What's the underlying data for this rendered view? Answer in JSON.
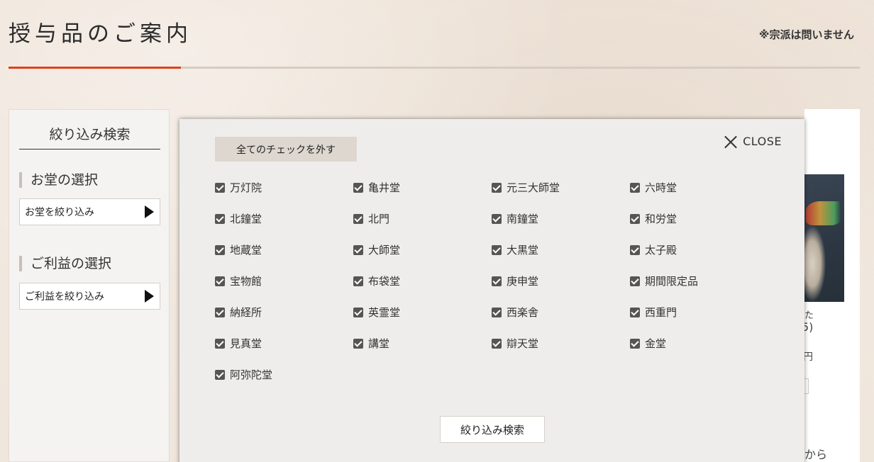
{
  "header": {
    "title": "授与品のご案内",
    "note": "※宗派は問いません"
  },
  "sidebar": {
    "heading": "絞り込み検索",
    "hall_section": {
      "title": "お堂の選択",
      "select_label": "お堂を絞り込み"
    },
    "benefit_section": {
      "title": "ご利益の選択",
      "select_label": "ご利益を絞り込み"
    }
  },
  "background": {
    "partial_texts": [
      "た",
      "5)",
      "円",
      "から"
    ]
  },
  "modal": {
    "uncheck_all_label": "全てのチェックを外す",
    "close_label": "CLOSE",
    "search_button_label": "絞り込み検索",
    "options": [
      {
        "label": "万灯院",
        "checked": true
      },
      {
        "label": "亀井堂",
        "checked": true
      },
      {
        "label": "元三大師堂",
        "checked": true
      },
      {
        "label": "六時堂",
        "checked": true
      },
      {
        "label": "北鐘堂",
        "checked": true
      },
      {
        "label": "北門",
        "checked": true
      },
      {
        "label": "南鐘堂",
        "checked": true
      },
      {
        "label": "和労堂",
        "checked": true
      },
      {
        "label": "地蔵堂",
        "checked": true
      },
      {
        "label": "大師堂",
        "checked": true
      },
      {
        "label": "大黒堂",
        "checked": true
      },
      {
        "label": "太子殿",
        "checked": true
      },
      {
        "label": "宝物館",
        "checked": true
      },
      {
        "label": "布袋堂",
        "checked": true
      },
      {
        "label": "庚申堂",
        "checked": true
      },
      {
        "label": "期間限定品",
        "checked": true
      },
      {
        "label": "納経所",
        "checked": true
      },
      {
        "label": "英霊堂",
        "checked": true
      },
      {
        "label": "西楽舎",
        "checked": true
      },
      {
        "label": "西重門",
        "checked": true
      },
      {
        "label": "見真堂",
        "checked": true
      },
      {
        "label": "講堂",
        "checked": true
      },
      {
        "label": "辯天堂",
        "checked": true
      },
      {
        "label": "金堂",
        "checked": true
      },
      {
        "label": "阿弥陀堂",
        "checked": true
      }
    ]
  },
  "colors": {
    "accent": "#e0401d",
    "modal_bg": "#efedeb"
  }
}
